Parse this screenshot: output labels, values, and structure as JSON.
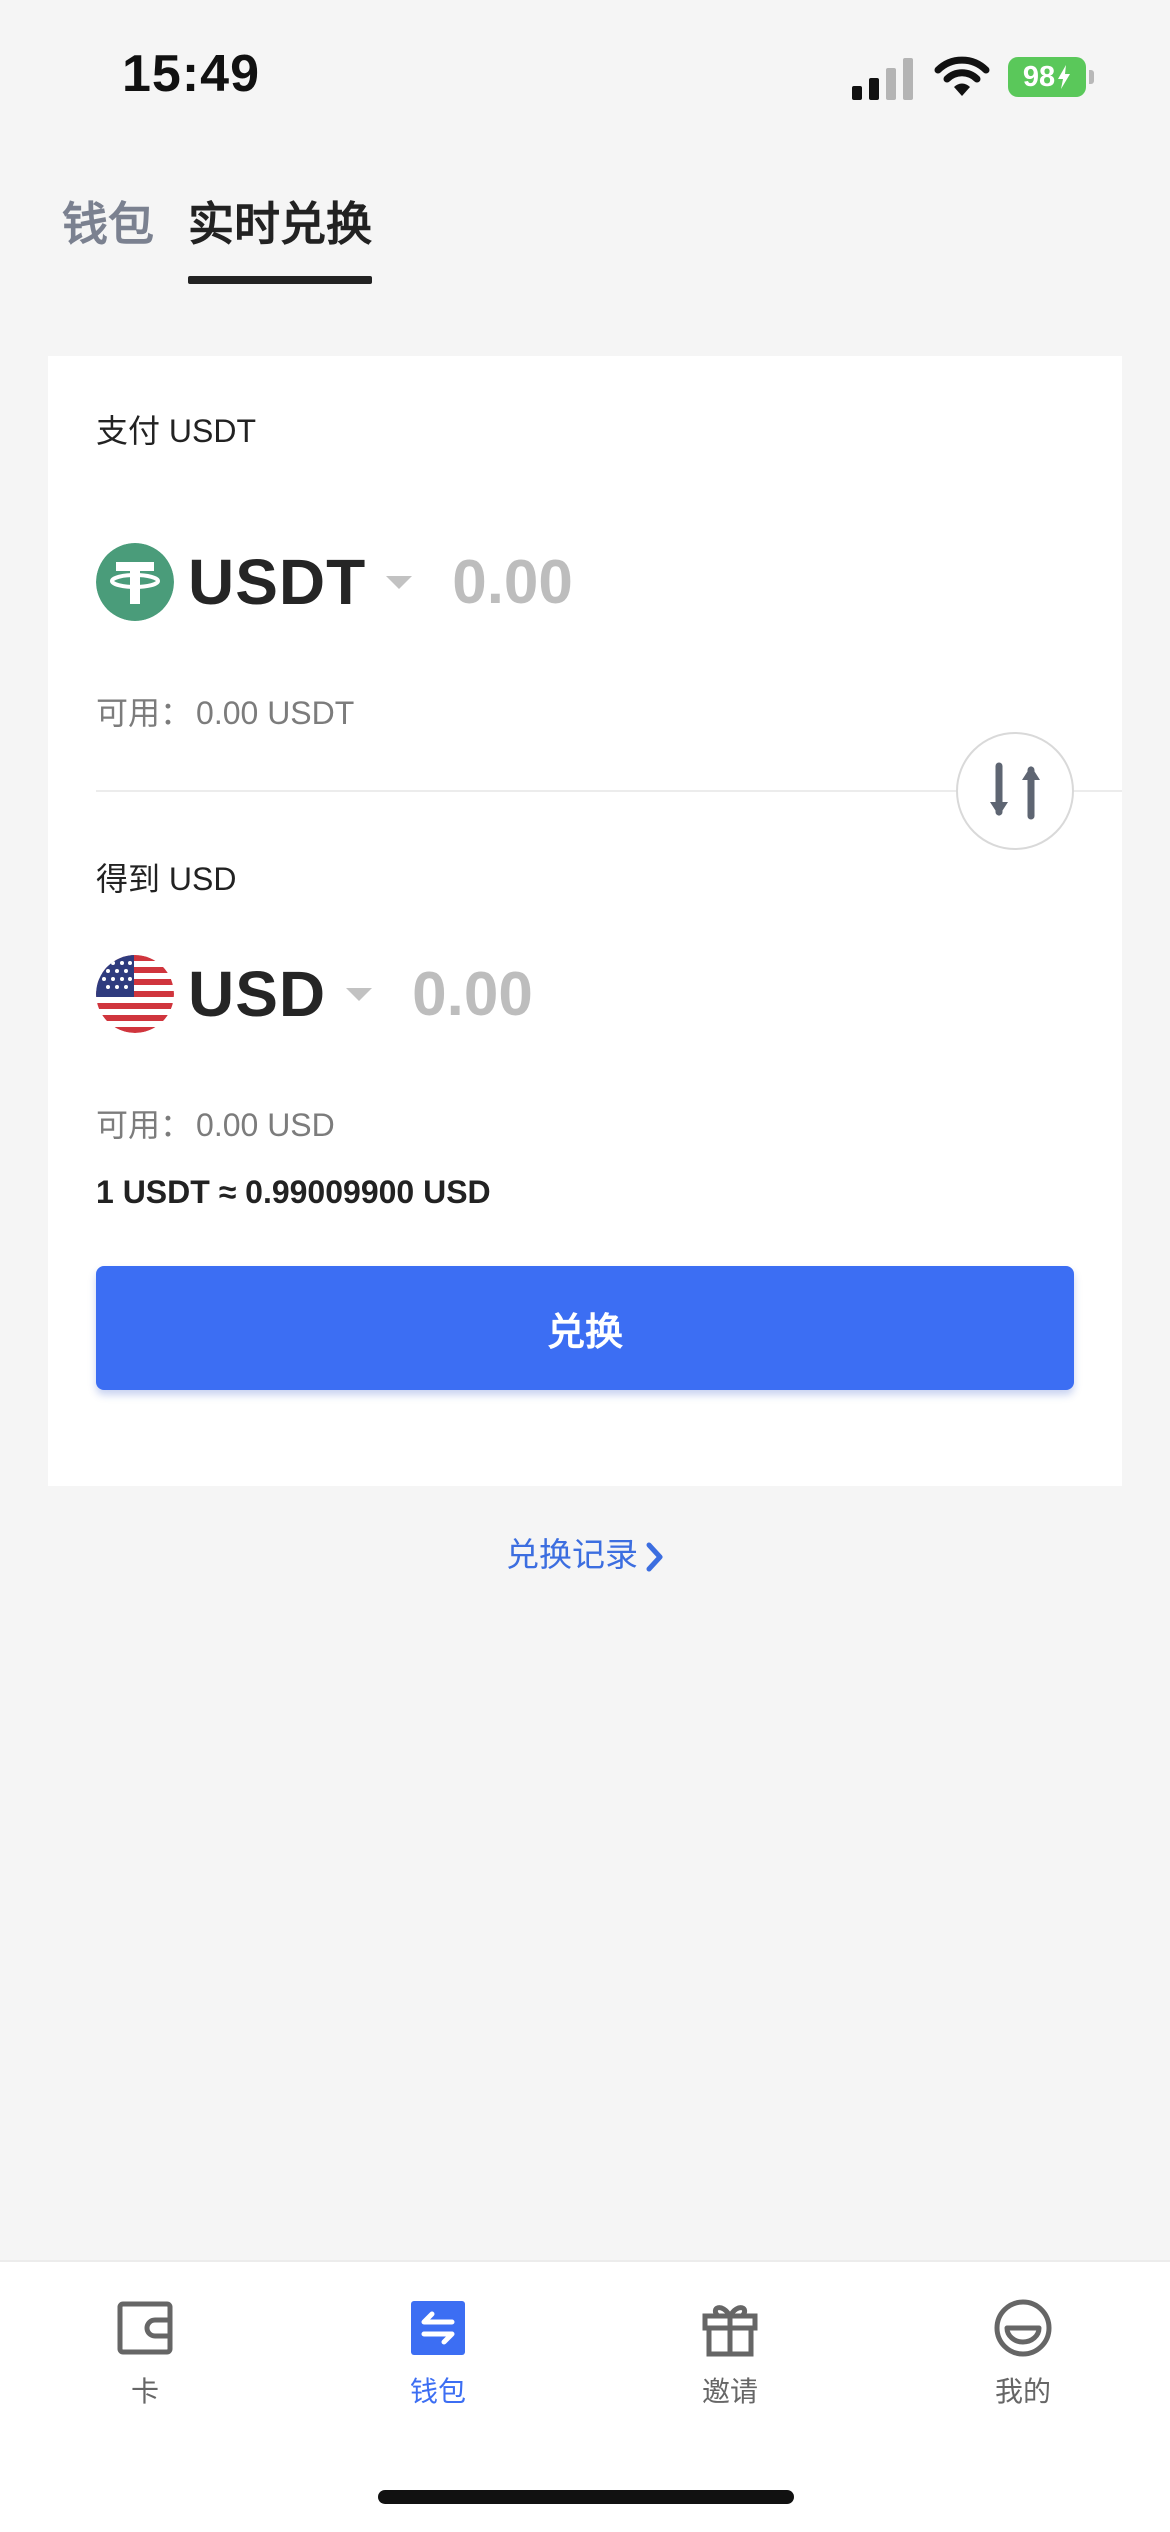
{
  "status_bar": {
    "time": "15:49",
    "battery": "98"
  },
  "top_tabs": [
    {
      "label": "钱包",
      "active": false
    },
    {
      "label": "实时兑换",
      "active": true
    }
  ],
  "exchange": {
    "pay": {
      "label": "支付 USDT",
      "currency": "USDT",
      "icon": "tether-icon",
      "amount_placeholder": "0.00",
      "available_prefix": "可用：",
      "available_value": "0.00 USDT"
    },
    "get": {
      "label": "得到 USD",
      "currency": "USD",
      "icon": "us-flag-icon",
      "amount_placeholder": "0.00",
      "available_prefix": "可用：",
      "available_value": "0.00 USD"
    },
    "rate": "1 USDT ≈ 0.99009900 USD",
    "button_label": "兑换",
    "history_link": "兑换记录"
  },
  "bottom_nav": [
    {
      "label": "卡",
      "icon": "card-icon",
      "active": false
    },
    {
      "label": "钱包",
      "icon": "wallet-swap-icon",
      "active": true
    },
    {
      "label": "邀请",
      "icon": "gift-icon",
      "active": false
    },
    {
      "label": "我的",
      "icon": "smile-icon",
      "active": false
    }
  ],
  "colors": {
    "accent": "#3c6ef3",
    "tether_green": "#4a9c7a",
    "battery_green": "#5ac85a",
    "background": "#f5f5f5"
  }
}
